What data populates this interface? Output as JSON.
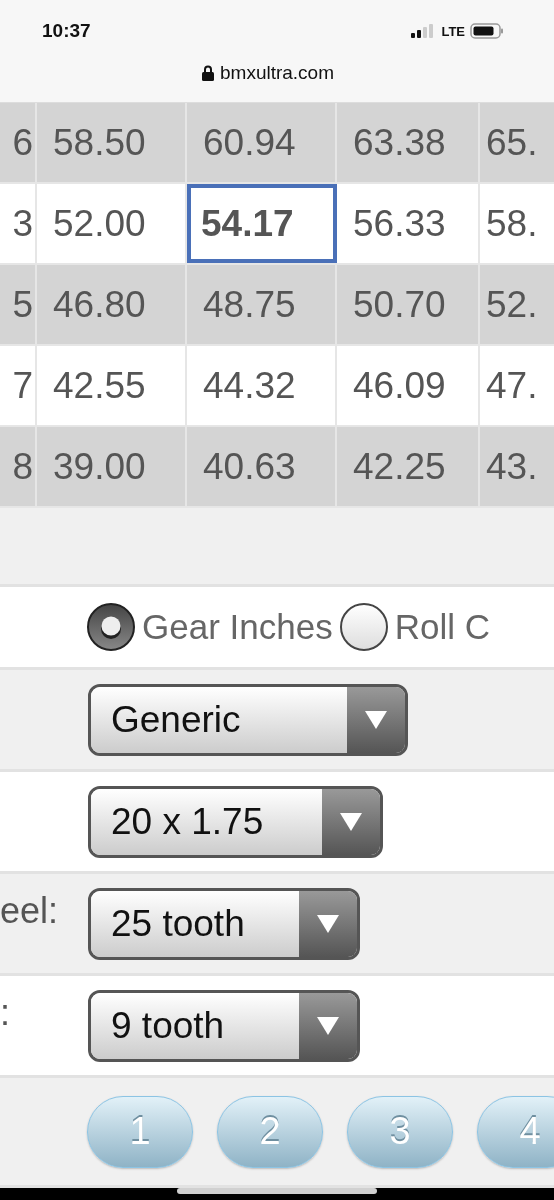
{
  "status_bar": {
    "time": "10:37",
    "network": "LTE"
  },
  "address_bar": {
    "url": "bmxultra.com"
  },
  "table": {
    "rows": [
      {
        "cells": [
          {
            "text": "6",
            "selected": false
          },
          {
            "text": "58.50",
            "selected": false
          },
          {
            "text": "60.94",
            "selected": false
          },
          {
            "text": "63.38",
            "selected": false
          },
          {
            "text": "65.",
            "selected": false
          }
        ]
      },
      {
        "cells": [
          {
            "text": "3",
            "selected": false
          },
          {
            "text": "52.00",
            "selected": false
          },
          {
            "text": "54.17",
            "selected": true
          },
          {
            "text": "56.33",
            "selected": false
          },
          {
            "text": "58.",
            "selected": false
          }
        ]
      },
      {
        "cells": [
          {
            "text": "5",
            "selected": false
          },
          {
            "text": "46.80",
            "selected": false
          },
          {
            "text": "48.75",
            "selected": false
          },
          {
            "text": "50.70",
            "selected": false
          },
          {
            "text": "52.",
            "selected": false
          }
        ]
      },
      {
        "cells": [
          {
            "text": "7",
            "selected": false
          },
          {
            "text": "42.55",
            "selected": false
          },
          {
            "text": "44.32",
            "selected": false
          },
          {
            "text": "46.09",
            "selected": false
          },
          {
            "text": "47.",
            "selected": false
          }
        ]
      },
      {
        "cells": [
          {
            "text": "8",
            "selected": false
          },
          {
            "text": "39.00",
            "selected": false
          },
          {
            "text": "40.63",
            "selected": false
          },
          {
            "text": "42.25",
            "selected": false
          },
          {
            "text": "43.",
            "selected": false
          }
        ]
      }
    ]
  },
  "unit_options": [
    {
      "label": "Gear Inches",
      "selected": true
    },
    {
      "label": "Roll C",
      "selected": false
    }
  ],
  "form_rows": [
    {
      "value": "Generic"
    },
    {
      "value": "20 x 1.75"
    },
    {
      "label": "eel:",
      "value": "25 tooth"
    },
    {
      "label": ":",
      "value": "9 tooth"
    }
  ],
  "buttons": [
    "1",
    "2",
    "3",
    "4"
  ]
}
